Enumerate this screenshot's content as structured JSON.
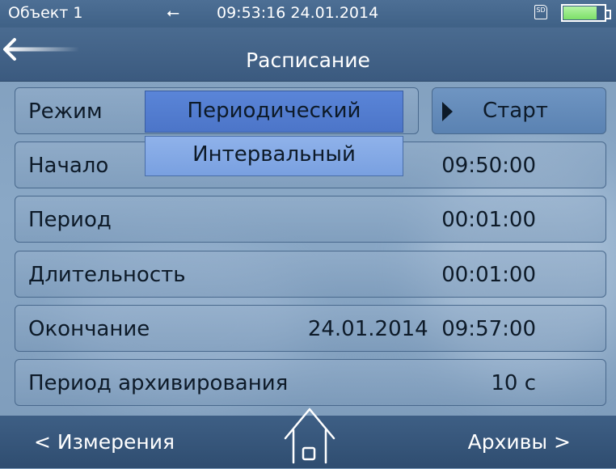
{
  "status": {
    "object": "Объект 1",
    "usb_icon": "usb-icon",
    "time": "09:53:16",
    "date": "24.01.2014",
    "sd_label": "SD",
    "battery_level": 0.78
  },
  "header": {
    "title": "Расписание",
    "back_icon": "back-arrow-icon"
  },
  "mode": {
    "label": "Режим",
    "selected": "Периодический",
    "options": [
      "Периодический",
      "Интервальный"
    ],
    "dropdown_option": "Интервальный"
  },
  "start_button": {
    "label": "Старт",
    "icon": "play-icon"
  },
  "rows": [
    {
      "label": "Начало",
      "value": "09:50:00"
    },
    {
      "label": "Период",
      "value": "00:01:00"
    },
    {
      "label": "Длительность",
      "value": "00:01:00"
    },
    {
      "label": "Окончание",
      "value": "24.01.2014  09:57:00"
    },
    {
      "label": "Период архивирования",
      "value": "10 с"
    }
  ],
  "footer": {
    "left": "< Измерения",
    "home_icon": "home-icon",
    "right": "Архивы >"
  }
}
